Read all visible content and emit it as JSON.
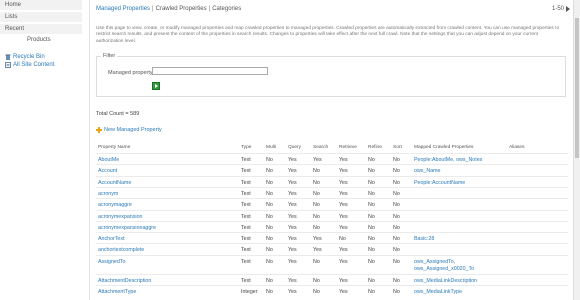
{
  "nav": {
    "home": "Home",
    "lists": "Lists",
    "recent": "Recent",
    "products": "Products",
    "recycle_bin": "Recycle Bin",
    "all_site_content": "All Site Content"
  },
  "tabs": {
    "managed": "Managed Properties",
    "crawled": "Crawled Properties",
    "categories": "Categories",
    "sep": "|"
  },
  "pager": {
    "range": "1-50"
  },
  "description": "Use this page to view, create, or modify managed properties and map crawled properties to managed properties. Crawled properties are automatically extracted from crawled content. You can use managed properties to restrict search results, and present the content of the properties in search results. Changes to properties will take effect after the next full crawl. Note that the settings that you can adjust depend on your current authorization level.",
  "filter": {
    "legend": "Filter",
    "label": "Managed property",
    "value": ""
  },
  "total_count": "Total Count = 589",
  "new_property": "New Managed Property",
  "table": {
    "columns": [
      "Property Name",
      "Type",
      "Multi",
      "Query",
      "Search",
      "Retrieve",
      "Refine",
      "Sort",
      "Mapped Crawled Properties",
      "Aliases"
    ],
    "rows": [
      {
        "name": "AboutMe",
        "type": "Text",
        "multi": "No",
        "query": "Yes",
        "search": "Yes",
        "retrieve": "Yes",
        "refine": "No",
        "sort": "No",
        "mapped": "People:AboutMe, ows_Notes",
        "aliases": ""
      },
      {
        "name": "Account",
        "type": "Text",
        "multi": "No",
        "query": "Yes",
        "search": "No",
        "retrieve": "Yes",
        "refine": "No",
        "sort": "No",
        "mapped": "ows_Name",
        "aliases": ""
      },
      {
        "name": "AccountName",
        "type": "Text",
        "multi": "No",
        "query": "Yes",
        "search": "No",
        "retrieve": "Yes",
        "refine": "No",
        "sort": "No",
        "mapped": "People:AccountName",
        "aliases": ""
      },
      {
        "name": "acronym",
        "type": "Text",
        "multi": "No",
        "query": "Yes",
        "search": "No",
        "retrieve": "Yes",
        "refine": "No",
        "sort": "No",
        "mapped": "",
        "aliases": ""
      },
      {
        "name": "acronymaggre",
        "type": "Text",
        "multi": "No",
        "query": "Yes",
        "search": "No",
        "retrieve": "Yes",
        "refine": "No",
        "sort": "No",
        "mapped": "",
        "aliases": ""
      },
      {
        "name": "acronymexpansion",
        "type": "Text",
        "multi": "No",
        "query": "Yes",
        "search": "No",
        "retrieve": "Yes",
        "refine": "No",
        "sort": "No",
        "mapped": "",
        "aliases": ""
      },
      {
        "name": "acronymexpansionaggre",
        "type": "Text",
        "multi": "No",
        "query": "Yes",
        "search": "No",
        "retrieve": "Yes",
        "refine": "No",
        "sort": "No",
        "mapped": "",
        "aliases": ""
      },
      {
        "name": "AnchorText",
        "type": "Text",
        "multi": "No",
        "query": "Yes",
        "search": "Yes",
        "retrieve": "No",
        "refine": "No",
        "sort": "No",
        "mapped": "Basic:28",
        "aliases": ""
      },
      {
        "name": "anchortextcomplete",
        "type": "Text",
        "multi": "No",
        "query": "Yes",
        "search": "Yes",
        "retrieve": "Yes",
        "refine": "No",
        "sort": "No",
        "mapped": "",
        "aliases": ""
      },
      {
        "name": "AssignedTo",
        "type": "Text",
        "multi": "No",
        "query": "Yes",
        "search": "No",
        "retrieve": "Yes",
        "refine": "No",
        "sort": "No",
        "mapped": "ows_AssignedTo,",
        "mapped2": "ows_Assigned_x0020_To",
        "aliases": ""
      },
      {
        "name": "AttachmentDescription",
        "type": "Text",
        "multi": "No",
        "query": "Yes",
        "search": "No",
        "retrieve": "Yes",
        "refine": "No",
        "sort": "No",
        "mapped": "ows_MediaLinkDescription",
        "aliases": ""
      },
      {
        "name": "AttachmentType",
        "type": "Integer",
        "multi": "No",
        "query": "Yes",
        "search": "No",
        "retrieve": "Yes",
        "refine": "No",
        "sort": "No",
        "mapped": "ows_MediaLinkType",
        "aliases": ""
      }
    ]
  },
  "colors": {
    "link": "#2a7ab8",
    "nav_bg": "#f2f2f2",
    "go_green": "#2f9a3b"
  }
}
